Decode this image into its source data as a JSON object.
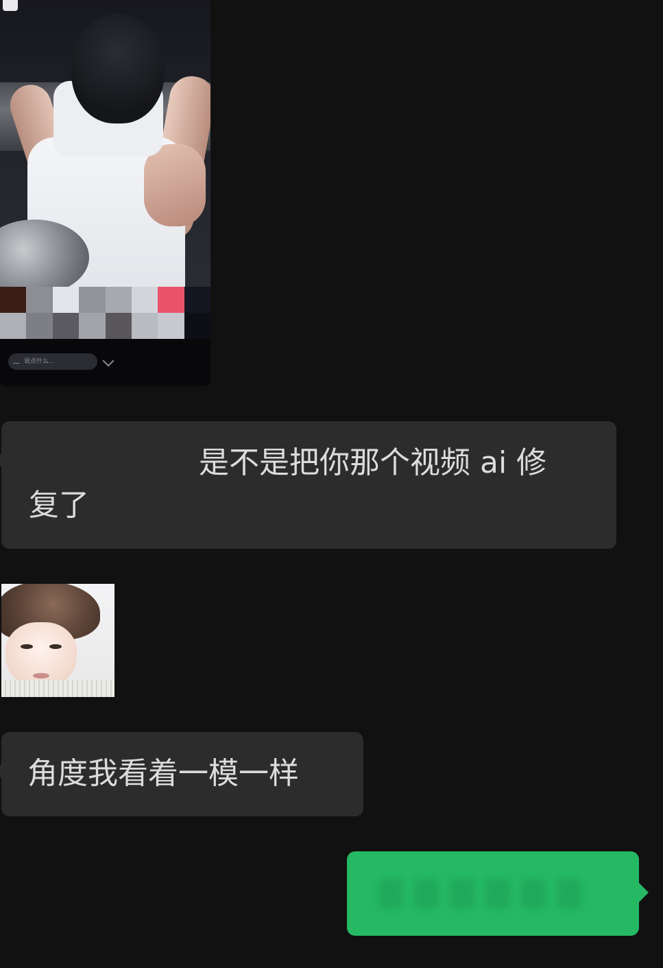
{
  "chat": {
    "video_message": {
      "comment_placeholder": "说点什么...",
      "mosaic_colors": [
        "#3a1e16",
        "#8d8e95",
        "#e3e4ec",
        "#939499",
        "#a8a9ae",
        "#d4d5dc",
        "#e8536a",
        "#141722",
        "#b0b1b6",
        "#7e7f86",
        "#5b5a63",
        "#a3a4a9",
        "#59565c",
        "#b8bbbf",
        "#c8c9d0",
        "#0d0f16"
      ]
    },
    "message_1": {
      "text_line1": "是不是把你那个视频 ai 修",
      "text_line2": "复了"
    },
    "message_2": {
      "text": "角度我看着一模一样"
    }
  },
  "colors": {
    "background": "#111111",
    "received_bubble": "#2c2c2c",
    "received_text": "#dcdcdc",
    "sent_bubble": "#25b964"
  }
}
